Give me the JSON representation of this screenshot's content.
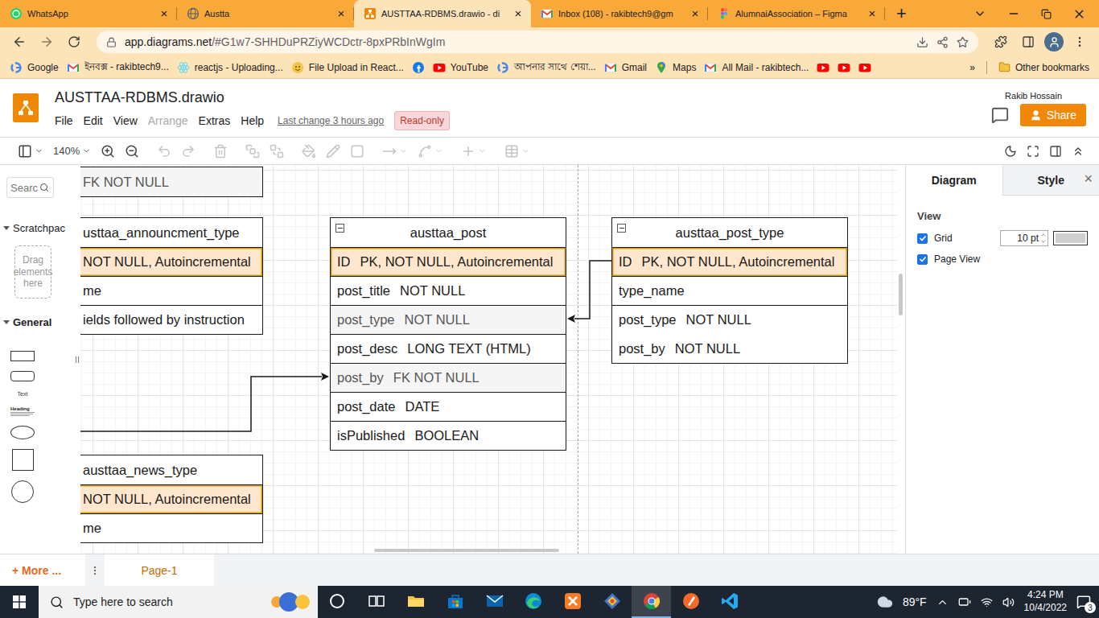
{
  "browser": {
    "tabs": [
      {
        "label": "WhatsApp",
        "kind": "whatsapp",
        "selected": false
      },
      {
        "label": "Austta",
        "kind": "globe",
        "selected": false
      },
      {
        "label": "AUSTTAA-RDBMS.drawio - di",
        "kind": "drawio",
        "selected": true
      },
      {
        "label": "Inbox (108) - rakibtech9@gm",
        "kind": "gmail",
        "selected": false
      },
      {
        "label": "AlumnaiAssociation – Figma",
        "kind": "figma",
        "selected": false
      }
    ],
    "close": "×",
    "new_tab": "+",
    "address": {
      "host": "app.diagrams.net",
      "path": "/#G1w7-SHHDuPRZiyWCDctr-8pxPRbInWgIm"
    },
    "bookmarks": [
      {
        "label": "Google",
        "kind": "google"
      },
      {
        "label": "ইনবক্স - rakibtech9...",
        "kind": "gmail"
      },
      {
        "label": "reactjs - Uploading...",
        "kind": "react"
      },
      {
        "label": "File Upload in React...",
        "kind": "file"
      },
      {
        "kind": "facebook"
      },
      {
        "label": "YouTube",
        "kind": "youtube"
      },
      {
        "label": "আপনার সাথে শেয়া...",
        "kind": "google"
      },
      {
        "label": "Gmail",
        "kind": "gmail"
      },
      {
        "label": "Maps",
        "kind": "maps"
      },
      {
        "label": "All Mail - rakibtech...",
        "kind": "gmail"
      },
      {
        "kind": "youtube"
      },
      {
        "kind": "youtube"
      },
      {
        "kind": "youtube"
      }
    ],
    "more": "»",
    "other_bookmarks": "Other bookmarks"
  },
  "app": {
    "title": "AUSTTAA-RDBMS.drawio",
    "menus": [
      {
        "label": "File",
        "disabled": false
      },
      {
        "label": "Edit",
        "disabled": false
      },
      {
        "label": "View",
        "disabled": false
      },
      {
        "label": "Arrange",
        "disabled": true
      },
      {
        "label": "Extras",
        "disabled": false
      },
      {
        "label": "Help",
        "disabled": false
      }
    ],
    "last_change": "Last change 3 hours ago",
    "badge": "Read-only",
    "user": "Rakib Hossain",
    "share": "Share"
  },
  "toolbar": {
    "groups": [
      [
        {
          "kind": "panel",
          "dropdown": true,
          "disabled": false
        },
        {
          "kind": "zoom",
          "label": "140%",
          "dropdown": true,
          "disabled": false
        },
        {
          "kind": "zoom-in",
          "dropdown": false,
          "disabled": false
        },
        {
          "kind": "zoom-out",
          "dropdown": false,
          "disabled": false
        }
      ],
      [
        {
          "kind": "undo",
          "dropdown": false,
          "disabled": true
        },
        {
          "kind": "redo",
          "dropdown": false,
          "disabled": true
        }
      ],
      [
        {
          "kind": "delete",
          "dropdown": false,
          "disabled": true
        }
      ],
      [
        {
          "kind": "to-front",
          "dropdown": false,
          "disabled": true
        },
        {
          "kind": "to-back",
          "dropdown": false,
          "disabled": true
        }
      ],
      [
        {
          "kind": "fill",
          "dropdown": false,
          "disabled": true
        },
        {
          "kind": "line",
          "dropdown": false,
          "disabled": true
        },
        {
          "kind": "shadow",
          "dropdown": false,
          "disabled": true
        }
      ],
      [
        {
          "kind": "connection",
          "dropdown": true,
          "disabled": true
        },
        {
          "kind": "waypoints",
          "dropdown": true,
          "disabled": true
        }
      ],
      [
        {
          "kind": "insert",
          "dropdown": true,
          "disabled": true
        }
      ],
      [
        {
          "kind": "table",
          "dropdown": true,
          "disabled": true
        }
      ]
    ],
    "right": [
      {
        "kind": "theme",
        "disabled": false
      },
      {
        "kind": "fullscreen",
        "disabled": false
      },
      {
        "kind": "format",
        "disabled": false
      },
      {
        "kind": "collapse",
        "disabled": false
      }
    ]
  },
  "sidebar": {
    "search": "Searc",
    "sections": [
      {
        "label": "Scratchpac",
        "expanded": true
      },
      {
        "label": "General",
        "expanded": true
      }
    ],
    "drop_hint": "Drag elements here",
    "shapes": [
      {
        "kind": "rect"
      },
      {
        "kind": "rounded"
      },
      {
        "kind": "text",
        "label": "Text"
      },
      {
        "kind": "heading",
        "label": "Heading"
      },
      {
        "kind": "ellipse"
      },
      {
        "kind": "square"
      },
      {
        "kind": "circle"
      }
    ],
    "more": "+ More ..."
  },
  "canvas": {
    "tables": [
      {
        "rows": [
          {
            "name": "FK NOT NULL",
            "kind": "fk"
          }
        ]
      },
      {
        "title": "usttaa_announcment_type",
        "rows": [
          {
            "name": "NOT NULL, Autoincremental",
            "kind": "pk"
          },
          {
            "name": "me",
            "kind": "field"
          },
          {
            "name": "ields followed by instruction",
            "kind": "field"
          }
        ]
      },
      {
        "title": "austtaa_post",
        "rows": [
          {
            "name": "ID",
            "spec": "PK, NOT NULL, Autoincremental",
            "kind": "pk"
          },
          {
            "name": "post_title",
            "spec": "NOT NULL",
            "kind": "field"
          },
          {
            "name": "post_type",
            "spec": "NOT NULL",
            "kind": "fk"
          },
          {
            "name": "post_desc",
            "spec": "LONG TEXT (HTML)",
            "kind": "field"
          },
          {
            "name": "post_by",
            "spec": "FK  NOT NULL",
            "kind": "fk"
          },
          {
            "name": "post_date",
            "spec": "DATE",
            "kind": "field"
          },
          {
            "name": "isPublished",
            "spec": "BOOLEAN",
            "kind": "field"
          }
        ]
      },
      {
        "title": "austtaa_post_type",
        "rows": [
          {
            "name": "ID",
            "spec": "PK, NOT NULL, Autoincremental",
            "kind": "pk"
          },
          {
            "name": "type_name",
            "kind": "field"
          },
          {
            "name": "post_type",
            "spec": "NOT NULL",
            "kind": "field"
          },
          {
            "name": "post_by",
            "spec": "NOT NULL",
            "kind": "attr"
          }
        ]
      },
      {
        "title": "austtaa_news_type",
        "rows": [
          {
            "name": "NOT NULL, Autoincremental",
            "kind": "pk"
          },
          {
            "name": "me",
            "kind": "field"
          }
        ]
      }
    ]
  },
  "format_panel": {
    "tabs": [
      {
        "label": "Diagram",
        "selected": true
      },
      {
        "label": "Style",
        "selected": false
      }
    ],
    "close": "×",
    "section": "View",
    "options": [
      {
        "label": "Grid",
        "checked": true
      },
      {
        "label": "Page View",
        "checked": true
      }
    ],
    "grid_size": "10 pt"
  },
  "pages": {
    "tabs": [
      {
        "label": "Page-1",
        "selected": true
      }
    ]
  },
  "taskbar": {
    "search": "Type here to search",
    "apps": [
      {
        "kind": "cortana",
        "active": false
      },
      {
        "kind": "taskview",
        "active": false
      },
      {
        "kind": "explorer",
        "active": false
      },
      {
        "kind": "store",
        "active": false
      },
      {
        "kind": "mail",
        "active": false
      },
      {
        "kind": "edge",
        "active": false
      },
      {
        "kind": "xampp",
        "active": false
      },
      {
        "kind": "git",
        "active": false
      },
      {
        "kind": "chrome",
        "active": true
      },
      {
        "kind": "pen",
        "active": false
      },
      {
        "kind": "vscode",
        "active": false
      }
    ],
    "weather": "89°F",
    "time": "4:24 PM",
    "date": "10/4/2022",
    "notifications": "3"
  }
}
